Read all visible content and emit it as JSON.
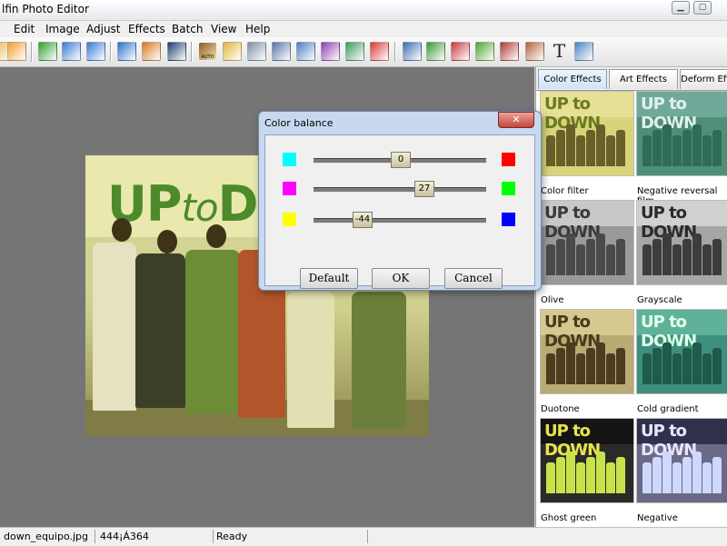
{
  "window": {
    "title": "lfin Photo Editor"
  },
  "menu": [
    "Edit",
    "Image",
    "Adjust",
    "Effects",
    "Batch",
    "View",
    "Help"
  ],
  "toolbar": {
    "buttons": [
      {
        "name": "open-folder-icon",
        "color": "#e8b84a"
      },
      {
        "name": "save-icon",
        "color": "#f0a030"
      },
      {
        "name": "back-arrow-icon",
        "color": "#2fa12f"
      },
      {
        "name": "undo-icon",
        "color": "#3a7bd5"
      },
      {
        "name": "redo-icon",
        "color": "#3a7bd5"
      },
      {
        "name": "resize-icon",
        "color": "#2a73c9"
      },
      {
        "name": "rotate-icon",
        "color": "#d97a1e"
      },
      {
        "name": "crop-icon",
        "color": "#1d3f6e"
      },
      {
        "name": "auto-enhance-icon",
        "color": "#8a5a2a"
      },
      {
        "name": "brightness-icon",
        "color": "#e2b53a"
      },
      {
        "name": "contrast-icon",
        "color": "#7f8fa6"
      },
      {
        "name": "half-circle-icon",
        "color": "#5577aa"
      },
      {
        "name": "saturation-icon",
        "color": "#4a80c2"
      },
      {
        "name": "add-frame-icon",
        "color": "#8c3fb0"
      },
      {
        "name": "color-balance-icon",
        "color": "#3a9b5e"
      },
      {
        "name": "color-wheel-icon",
        "color": "#d83a3a"
      },
      {
        "name": "people-icon",
        "color": "#3f6fb0"
      },
      {
        "name": "landscape-icon",
        "color": "#3a9a3a"
      },
      {
        "name": "mosaic-icon",
        "color": "#c93a3a"
      },
      {
        "name": "fireworks-icon",
        "color": "#4ca830"
      },
      {
        "name": "zoom-icon",
        "color": "#b03a3a"
      },
      {
        "name": "border-icon",
        "color": "#b4643a"
      },
      {
        "name": "text-icon",
        "color": "#222222"
      },
      {
        "name": "layout-icon",
        "color": "#4a86c4"
      }
    ],
    "text_glyph": "T",
    "auto_label": "AUTO"
  },
  "dialog": {
    "title": "Color balance",
    "close_glyph": "✕",
    "sliders": [
      {
        "left_color": "#00ffff",
        "right_color": "#ff0000",
        "value": "0",
        "fraction": 0.5
      },
      {
        "left_color": "#ff00ff",
        "right_color": "#00ff00",
        "value": "27",
        "fraction": 0.635
      },
      {
        "left_color": "#ffff00",
        "right_color": "#0000ff",
        "value": "-44",
        "fraction": 0.28
      }
    ],
    "buttons": {
      "default": "Default",
      "ok": "OK",
      "cancel": "Cancel"
    }
  },
  "panel": {
    "tabs": [
      "Color Effects",
      "Art Effects",
      "Deform Effe"
    ],
    "thumb_logo": "UP to DOWN",
    "effects": [
      {
        "label": "Color filter",
        "bg": "#d8d47a",
        "banner": "#e6e095",
        "logo": "#6b7a20",
        "people": "#6a5f2a"
      },
      {
        "label": "Negative reversal film",
        "bg": "#4f8f7a",
        "banner": "#6fa99a",
        "logo": "#e0f0ea",
        "people": "#2f6b55"
      },
      {
        "label": "Olive",
        "bg": "#9a9a9a",
        "banner": "#c8c8c8",
        "logo": "#3a3a3a",
        "people": "#4a4a4a"
      },
      {
        "label": "Grayscale",
        "bg": "#a6a6a6",
        "banner": "#d0d0d0",
        "logo": "#2a2a2a",
        "people": "#3c3c3c"
      },
      {
        "label": "Duotone",
        "bg": "#b9ab74",
        "banner": "#d6c990",
        "logo": "#4a3a1a",
        "people": "#4e3b20"
      },
      {
        "label": "Cold gradient",
        "bg": "#3f8f7f",
        "banner": "#5fb29a",
        "logo": "#dfffe8",
        "people": "#1f5a4a"
      },
      {
        "label": "Ghost green",
        "bg": "#2a2a2a",
        "banner": "#141414",
        "logo": "#e9e34a",
        "people": "#c8e34a"
      },
      {
        "label": "Negative",
        "bg": "#6a6a86",
        "banner": "#30304a",
        "logo": "#e6e6ff",
        "people": "#cfd8ff"
      }
    ]
  },
  "canvas": {
    "logo_main": "UP",
    "logo_to": "to",
    "logo_tail": "D"
  },
  "status": [
    "down_equipo.jpg",
    "444¡Á364",
    "Ready"
  ]
}
